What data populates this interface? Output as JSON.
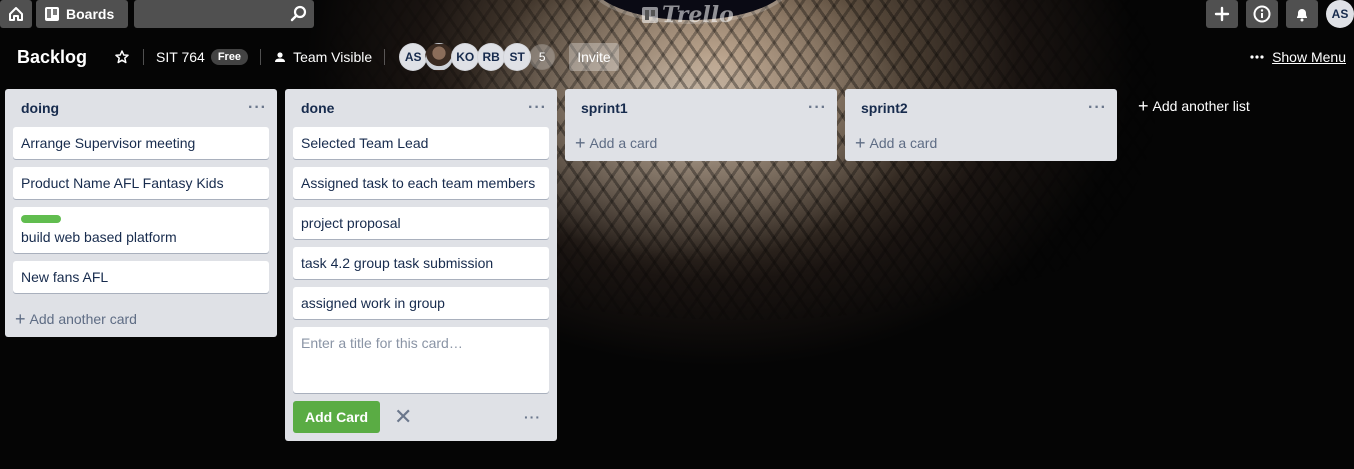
{
  "topbar": {
    "boards_label": "Boards",
    "logo_text": "Trello",
    "user_initials": "AS"
  },
  "board": {
    "name": "Backlog",
    "team": "SIT 764",
    "plan_badge": "Free",
    "visibility": "Team Visible",
    "members": [
      "AS",
      "",
      "KO",
      "RB",
      "ST"
    ],
    "extra_members": "5",
    "invite_label": "Invite",
    "show_menu_label": "Show Menu"
  },
  "lists": [
    {
      "title": "doing",
      "cards": [
        {
          "text": "Arrange Supervisor meeting"
        },
        {
          "text": "Product Name AFL Fantasy Kids"
        },
        {
          "text": "build web based platform",
          "label_color": "#61bd4f"
        },
        {
          "text": "New fans AFL"
        }
      ],
      "add_label": "Add another card"
    },
    {
      "title": "done",
      "cards": [
        {
          "text": "Selected Team Lead"
        },
        {
          "text": "Assigned task to each team members"
        },
        {
          "text": "project proposal"
        },
        {
          "text": "task 4.2 group task submission"
        },
        {
          "text": "assigned work in group"
        }
      ],
      "composer": {
        "placeholder": "Enter a title for this card…",
        "button_label": "Add Card"
      }
    },
    {
      "title": "sprint1",
      "cards": [],
      "add_label": "Add a card"
    },
    {
      "title": "sprint2",
      "cards": [],
      "add_label": "Add a card"
    }
  ],
  "add_list_label": "Add another list",
  "colors": {
    "list_bg": "#dfe1e6",
    "add_button": "#5aac44",
    "label_green": "#61bd4f"
  }
}
